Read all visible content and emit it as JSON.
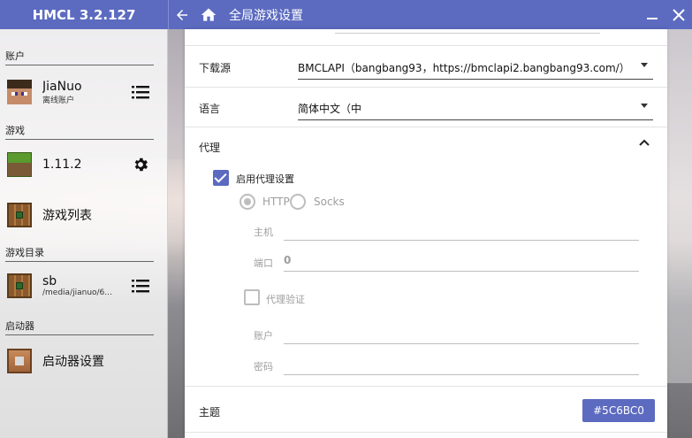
{
  "app": {
    "title": "HMCL 3.2.127",
    "page_title": "全局游戏设置",
    "accent_color": "#5C6BC0"
  },
  "sidebar": {
    "sections": {
      "account": "账户",
      "game": "游戏",
      "profile": "游戏目录",
      "launcher": "启动器"
    },
    "account": {
      "name": "JiaNuo",
      "type": "离线账户"
    },
    "game_version": {
      "name": "1.11.2"
    },
    "game_list": {
      "name": "游戏列表"
    },
    "profile_item": {
      "name": "sb",
      "path": "/media/jianuo/6..."
    },
    "launcher_settings": {
      "name": "启动器设置"
    }
  },
  "settings": {
    "download_source": {
      "label": "下载源",
      "value": "BMCLAPI（bangbang93，https://bmclapi2.bangbang93.com/）"
    },
    "language": {
      "label": "语言",
      "value": "简体中文（中"
    },
    "proxy": {
      "label": "代理",
      "enable_label": "启用代理设置",
      "enabled": true,
      "types": [
        "HTTP",
        "Socks"
      ],
      "selected_type": "HTTP",
      "host_label": "主机",
      "host_value": "",
      "port_label": "端口",
      "port_value": "0",
      "auth_label": "代理验证",
      "auth_enabled": false,
      "user_label": "账户",
      "user_value": "",
      "password_label": "密码",
      "password_value": ""
    },
    "theme": {
      "label": "主题",
      "value": "#5C6BC0"
    }
  }
}
